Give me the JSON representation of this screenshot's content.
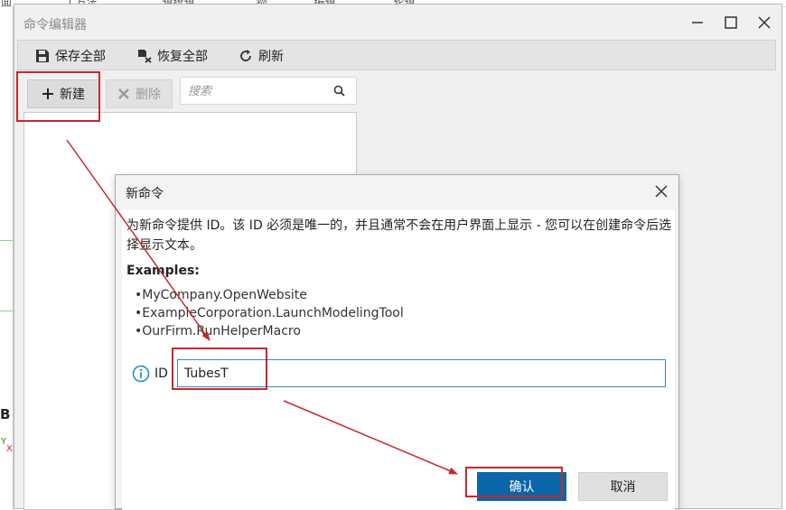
{
  "background": {
    "topbar_fragments": [
      "面",
      "...工方法",
      "...辑统辑",
      "...物",
      "...编辑",
      "...轮辑"
    ],
    "left_letter": "B",
    "axis_y": "Y",
    "axis_x": "X"
  },
  "editor": {
    "title": "命令编辑器",
    "toolbar": {
      "save_all": "保存全部",
      "restore_all": "恢复全部",
      "refresh": "刷新"
    },
    "new_label": "新建",
    "delete_label": "删除",
    "search_placeholder": "搜索"
  },
  "dialog": {
    "title": "新命令",
    "description": "为新命令提供 ID。该 ID 必须是唯一的，并且通常不会在用户界面上显示 - 您可以在创建命令后选择显示文本。",
    "examples_title": "Examples:",
    "examples": [
      "•MyCompany.OpenWebsite",
      "•ExampleCorporation.LaunchModelingTool",
      "•OurFirm.RunHelperMacro"
    ],
    "id_label": "ID",
    "id_value": "TubesT",
    "ok_label": "确认",
    "cancel_label": "取消"
  },
  "colors": {
    "accent": "#0a66a8",
    "annotation": "#c9282a",
    "input_border": "#3c85c4"
  }
}
